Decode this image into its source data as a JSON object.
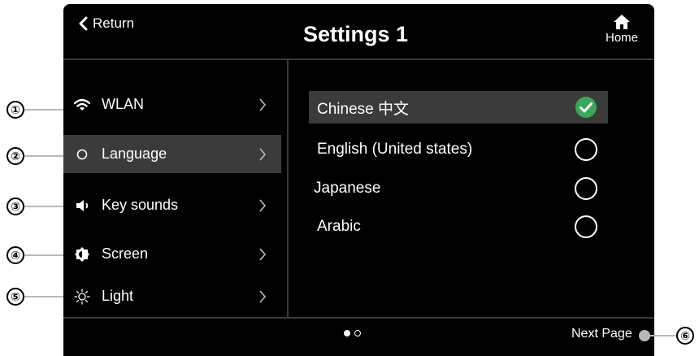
{
  "header": {
    "back_label": "Return",
    "title": "Settings 1",
    "home_label": "Home"
  },
  "sidebar": {
    "items": [
      {
        "label": "WLAN",
        "icon": "wifi-icon",
        "active": false
      },
      {
        "label": "Language",
        "icon": "circle-icon",
        "active": true
      },
      {
        "label": "Key sounds",
        "icon": "speaker-icon",
        "active": false
      },
      {
        "label": "Screen",
        "icon": "brightness-icon",
        "active": false
      },
      {
        "label": "Light",
        "icon": "sun-icon",
        "active": false
      }
    ]
  },
  "languages": {
    "options": [
      {
        "label": "Chinese 中文",
        "selected": true
      },
      {
        "label": "English (United states)",
        "selected": false
      },
      {
        "label": "Japanese",
        "selected": false
      },
      {
        "label": "Arabic",
        "selected": false
      }
    ]
  },
  "footer": {
    "pages_total": 2,
    "current_page": 1,
    "next_label": "Next Page"
  },
  "callouts": [
    "①",
    "②",
    "③",
    "④",
    "⑤",
    "⑥"
  ],
  "colors": {
    "screen_bg": "#000000",
    "active_row": "#3b3b3b",
    "check_green": "#3aa856",
    "callout_line": "#b9b9b9"
  }
}
